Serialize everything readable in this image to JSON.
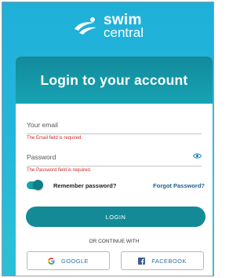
{
  "brand": {
    "line1": "swim",
    "line2": "central"
  },
  "card": {
    "title": "Login to your account"
  },
  "email": {
    "label": "Your email",
    "error": "The Email field is required."
  },
  "password": {
    "label": "Password",
    "error": "The Password field is required."
  },
  "remember": {
    "label": "Remember password?",
    "enabled": true
  },
  "forgot": {
    "label": "Forgot Password?"
  },
  "login": {
    "label": "LOGIN"
  },
  "continue": {
    "label": "OR CONTINUE WITH"
  },
  "social": {
    "google": {
      "label": "GOOGLE",
      "icon": "google-icon"
    },
    "facebook": {
      "label": "FACEBOOK",
      "icon": "facebook-icon"
    }
  },
  "colors": {
    "background": "#23b6da",
    "header": "#17a3b2",
    "button": "#148a96",
    "error": "#d02626",
    "link": "#1a5f8f"
  }
}
